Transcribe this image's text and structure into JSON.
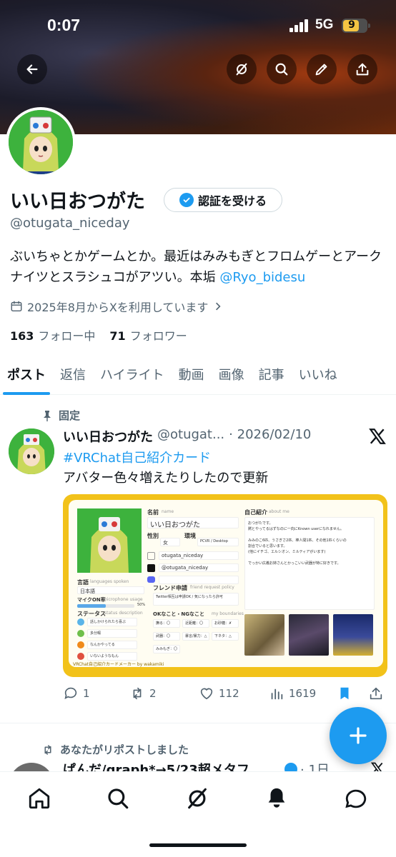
{
  "status_bar": {
    "time": "0:07",
    "network": "5G",
    "battery": "9"
  },
  "profile": {
    "display_name": "いい日おつがた",
    "verify_label": "認証を受ける",
    "handle": "@otugata_niceday",
    "bio_text": "ぶいちゃとかゲームとか。最近はみみもぎとフロムゲーとアークナイツとスラシュコがアツい。本垢",
    "bio_mention": "@Ryo_bidesu",
    "joined": "2025年8月からXを利用しています",
    "following_count": "163",
    "following_label": "フォロー中",
    "followers_count": "71",
    "followers_label": "フォロワー"
  },
  "tabs": [
    "ポスト",
    "返信",
    "ハイライト",
    "動画",
    "画像",
    "記事",
    "いいね"
  ],
  "pinned_post": {
    "pinned_label": "固定",
    "author": "いい日おつがた",
    "handle": "@otugat...",
    "date": "· 2026/02/10",
    "hashtag": "#VRChat自己紹介カード",
    "text": "アバター色々増えたりしたので更新",
    "card": {
      "name_label": "名前",
      "name_sub": "name",
      "name_value": "いい日おつがた",
      "gender_label": "性別",
      "gender_value": "女",
      "env_label": "環境",
      "env_value": "PCVR / Desktop",
      "vrc_id": "otugata_niceday",
      "x_id": "@otugata_niceday",
      "lang_label": "言語",
      "lang_sub": "languages spoken",
      "lang_value": "日本語",
      "mic_label": "マイクON率",
      "mic_sub": "microphone usage",
      "mic_value": "50%",
      "mic_fraction": 0.5,
      "friend_label": "フレンド申請",
      "friend_sub": "friend request policy",
      "friend_value": "Twitter相互は申請OK / 気になったら許可",
      "status_label": "ステータス",
      "status_sub": "status description",
      "statuses": [
        {
          "text": "話しかけられたら喜ぶ",
          "color": "#5ab4e8"
        },
        {
          "text": "多分暇",
          "color": "#6fbf4a"
        },
        {
          "text": "なんかやってる",
          "color": "#f08a1a"
        },
        {
          "text": "いないようなもん",
          "color": "#e05040"
        }
      ],
      "ok_label": "OKなこと・NGなこと",
      "ok_sub": "my boundaries",
      "ok_items": [
        "撫る：〇",
        "近距離：〇",
        "お砂糖：✗",
        "武器：〇",
        "暴言/暴力：△",
        "下ネタ：△",
        "みみもぎ：〇"
      ],
      "intro_label": "自己紹介",
      "intro_sub": "about me",
      "intro_lines": [
        "おつがたです。",
        "黙とやってるはずなのに一向にKnown userになれません。",
        "",
        "みみのこ6匹、うさぎさ2匹、棒人間1匹、その他1匹くらいの",
        "割合でいると思います。",
        "(他にイチゴ、エルシオン、ミルティアがいます)",
        "",
        "でっかい広義お姉さんとかっこいい武器が特に好きです。"
      ],
      "footer": "VRChat自己紹介カードメーカー by wakamiki"
    },
    "stats": {
      "replies": "1",
      "reposts": "2",
      "likes": "112",
      "views": "1619"
    }
  },
  "next_post": {
    "repost_label": "あなたがリポストしました",
    "author": "ぱんだ/graph*→5/23超メタフ",
    "meta": "· 1日"
  },
  "nav": [
    "home-icon",
    "search-icon",
    "grok-icon",
    "notifications-icon",
    "messages-icon"
  ],
  "colors": {
    "accent": "#1d9bf0",
    "card_frame": "#f2c21a",
    "avatar_bg": "#3db23d"
  }
}
